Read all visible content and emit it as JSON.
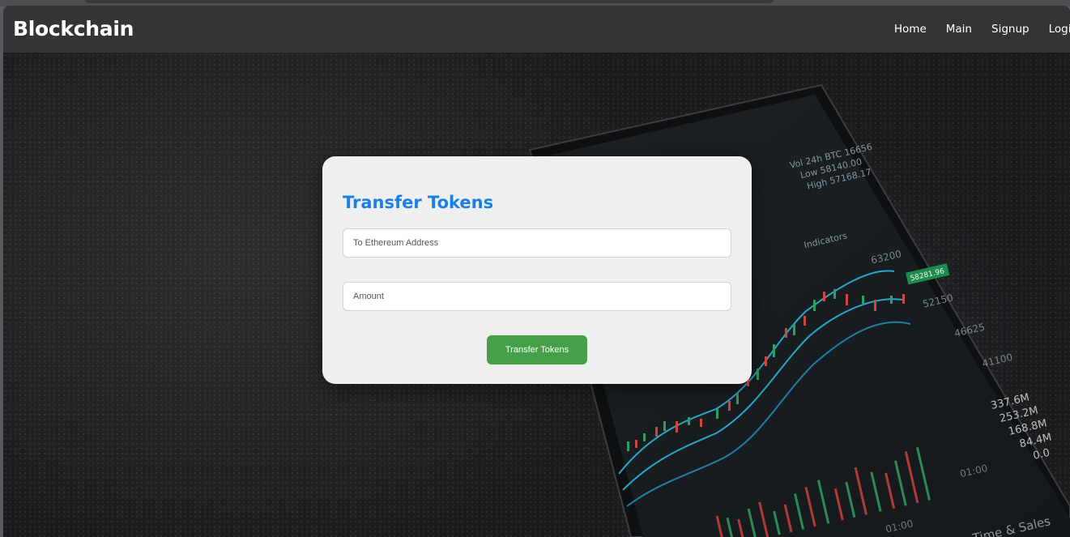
{
  "navbar": {
    "brand": "Blockchain",
    "links": [
      {
        "label": "Home"
      },
      {
        "label": "Main"
      },
      {
        "label": "Signup"
      },
      {
        "label": "Login"
      }
    ]
  },
  "background_image": {
    "price_labels": [
      "63200",
      "58281.96",
      "52150",
      "46625",
      "41100"
    ],
    "volume_labels": [
      "337.6M",
      "253.2M",
      "168.8M",
      "84.4M",
      "0.0"
    ],
    "time_labels": [
      "01:00",
      "01:00"
    ],
    "header_text": [
      "Vol 24h BTC 16656",
      "Low 58140.00",
      "High 57168.17"
    ],
    "tab_text": [
      "Indicators"
    ],
    "footer_text": "Time & Sales"
  },
  "transfer_form": {
    "title": "Transfer Tokens",
    "address_placeholder": "To Ethereum Address",
    "address_value": "",
    "amount_placeholder": "Amount",
    "amount_value": "",
    "submit_label": "Transfer Tokens"
  },
  "colors": {
    "navbar_bg": "#343436",
    "title_blue": "#1a7fe6",
    "button_green": "#46a049",
    "card_bg": "#efefef"
  }
}
